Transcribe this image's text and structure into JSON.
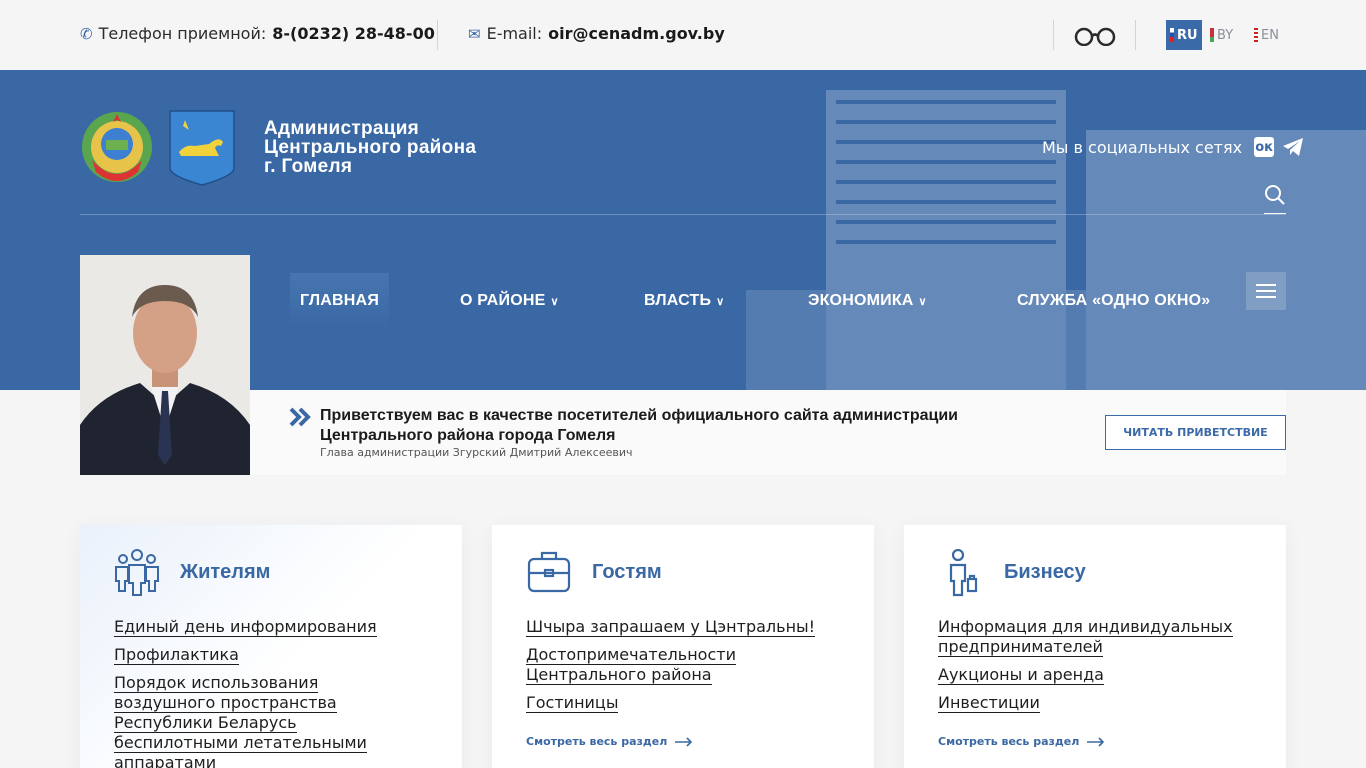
{
  "topbar": {
    "phone_label": "Телефон приемной:",
    "phone_value": "8-(0232) 28-48-00",
    "email_label": "E-mail:",
    "email_value": "oir@cenadm.gov.by",
    "languages": [
      {
        "code": "RU",
        "active": true
      },
      {
        "code": "BY",
        "active": false
      },
      {
        "code": "EN",
        "active": false
      }
    ]
  },
  "header": {
    "title_line1": "Администрация",
    "title_line2": "Центрального района",
    "title_line3": "г. Гомеля",
    "social_label": "Мы в социальных сетях",
    "ok_glyph": "ок"
  },
  "nav": {
    "items": [
      {
        "label": "ГЛАВНАЯ",
        "active": true
      },
      {
        "label": "О РАЙОНЕ",
        "dropdown": true
      },
      {
        "label": "ВЛАСТЬ",
        "dropdown": true
      },
      {
        "label": "ЭКОНОМИКА",
        "dropdown": true
      },
      {
        "label": "СЛУЖБА «ОДНО ОКНО»"
      }
    ]
  },
  "greeting": {
    "text": "Приветствуем вас в качестве посетителей официального сайта администрации Центрального района города Гомеля",
    "author": "Глава администрации Згурский Дмитрий Алексеевич",
    "button": "ЧИТАТЬ ПРИВЕТСТВИЕ"
  },
  "cards": [
    {
      "title": "Жителям",
      "icon": "people-icon",
      "links": [
        "Единый день информирования",
        "Профилактика",
        "Порядок использования воздушного пространства Республики Беларусь беспилотными летательными аппаратами"
      ]
    },
    {
      "title": "Гостям",
      "icon": "suitcase-icon",
      "links": [
        "Шчыра запрашаем у Цэнтральны!",
        "Достопримечательности Центрального района",
        "Гостиницы"
      ],
      "see_all": "Смотреть весь раздел"
    },
    {
      "title": "Бизнесу",
      "icon": "businessman-icon",
      "links": [
        "Информация для индивидуальных предпринимателей",
        "Аукционы и аренда",
        "Инвестиции"
      ],
      "see_all": "Смотреть весь раздел"
    }
  ],
  "colors": {
    "brand": "#3a68a4",
    "background": "#f5f5f6"
  }
}
